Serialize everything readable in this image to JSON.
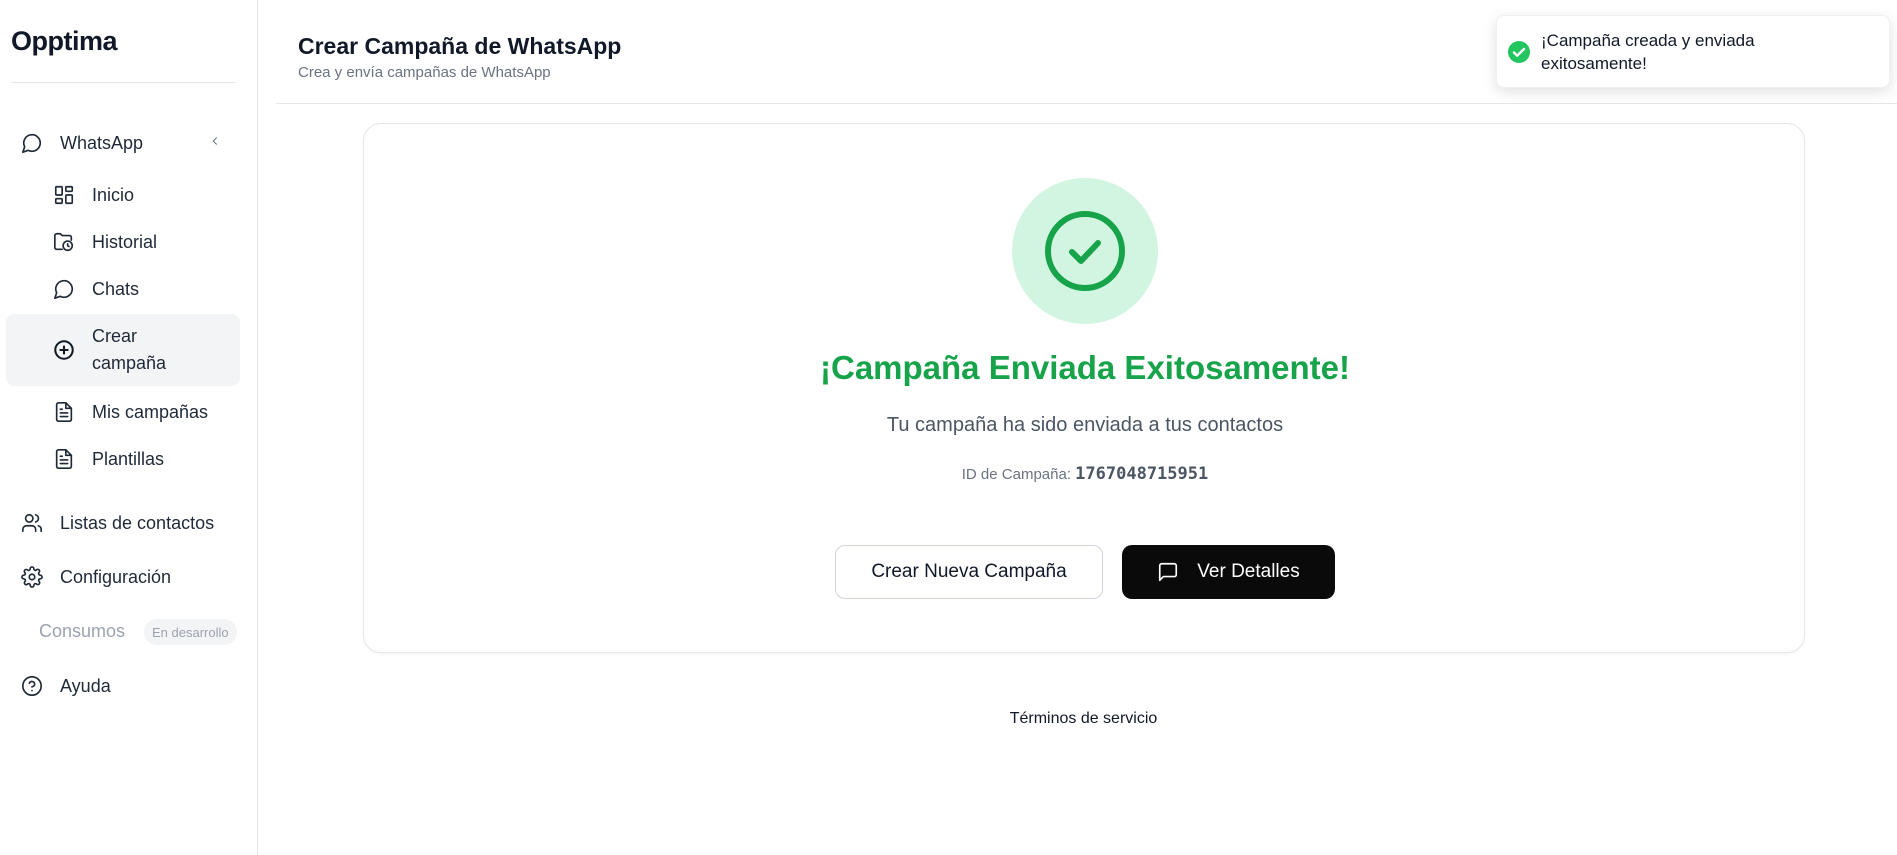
{
  "brand": {
    "name": "Opptima"
  },
  "sidebar": {
    "whatsapp_label": "WhatsApp",
    "sub_items": [
      {
        "label": "Inicio",
        "icon": "dashboard-icon"
      },
      {
        "label": "Historial",
        "icon": "folder-clock-icon"
      },
      {
        "label": "Chats",
        "icon": "chat-bubble-icon"
      },
      {
        "label_line1": "Crear",
        "label_line2": "campaña",
        "icon": "plus-circle-icon",
        "active": true
      },
      {
        "label": "Mis campañas",
        "icon": "document-icon"
      },
      {
        "label": "Plantillas",
        "icon": "document-icon"
      }
    ],
    "contacts_label": "Listas de contactos",
    "settings_label": "Configuración",
    "consumos_label": "Consumos",
    "consumos_badge": "En desarrollo",
    "help_label": "Ayuda"
  },
  "header": {
    "title": "Crear Campaña de WhatsApp",
    "subtitle": "Crea y envía campañas de WhatsApp"
  },
  "card": {
    "title": "¡Campaña Enviada Exitosamente!",
    "subtitle": "Tu campaña ha sido enviada a tus contactos",
    "id_label": "ID de Campaña:",
    "id_value": "1767048715951",
    "new_campaign_button": "Crear Nueva Campaña",
    "details_button": "Ver Detalles"
  },
  "footer": {
    "terms": "Términos de servicio"
  },
  "toast": {
    "message": "¡Campaña creada y enviada exitosamente!"
  },
  "colors": {
    "success": "#16a34a",
    "success_bg": "#d1f5e0",
    "primary_button": "#0a0a0a",
    "active_nav_bg": "#f3f4f6"
  }
}
